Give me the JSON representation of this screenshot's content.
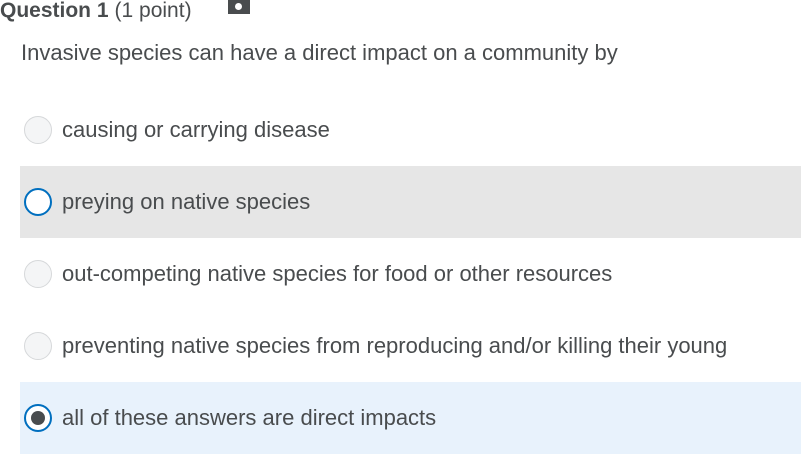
{
  "question": {
    "title": "Question 1",
    "points": "(1 point)",
    "flag_icon": "flag-icon",
    "text": "Invasive species can have a direct impact on a community by"
  },
  "choices": [
    {
      "label": "causing or carrying disease",
      "state": "unselected"
    },
    {
      "label": "preying on native species",
      "state": "hovered"
    },
    {
      "label": "out-competing native species for food or other resources",
      "state": "unselected"
    },
    {
      "label": "preventing native species from reproducing and/or killing their young",
      "state": "unselected"
    },
    {
      "label": "all of these answers are direct impacts",
      "state": "selected"
    }
  ],
  "colors": {
    "text": "#494c4e",
    "hover_background": "#e6e6e6",
    "selected_background": "#e8f2fc",
    "radio_accent": "#006fbf"
  }
}
